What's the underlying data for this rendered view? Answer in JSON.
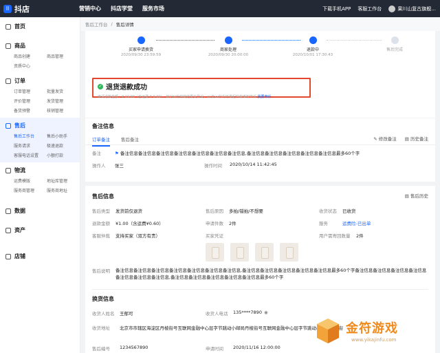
{
  "app": {
    "title": "抖店"
  },
  "topnav": [
    "营销中心",
    "抖店学堂",
    "服务市场"
  ],
  "topright": {
    "download": "下载手机APP",
    "workbench": "客服工作台",
    "shop": "果川山复古旗舰..."
  },
  "sidebar": {
    "home": "首页",
    "groups": [
      {
        "title": "商品",
        "items": [
          "商品创建",
          "商品管理",
          "资质中心"
        ]
      },
      {
        "title": "订单",
        "items": [
          "订单管理",
          "批量发货",
          "评价管理",
          "发货管理",
          "备货预警",
          "核销管理"
        ]
      },
      {
        "title": "售后",
        "items": [
          "售后工作台",
          "售后小助手",
          "服务请求",
          "极速退款",
          "客服电话设置",
          "小额打款"
        ]
      },
      {
        "title": "物流",
        "items": [
          "运费模版",
          "地址库管理",
          "服务商管理",
          "服务商地址"
        ]
      }
    ],
    "bottom": [
      "数据",
      "资产",
      "店铺"
    ]
  },
  "breadcrumb": [
    "售后工作台",
    "/",
    "售后详情"
  ],
  "steps": [
    {
      "label": "买家申请换货",
      "time": "2020/09/30 23:59:59"
    },
    {
      "label": "商家处理",
      "time": "2020/09/30 20:00:00"
    },
    {
      "label": "退款中",
      "time": "2020/10/01 17:30:43"
    },
    {
      "label": "售后完成",
      "time": ""
    }
  ],
  "status": {
    "title": "退货退款成功",
    "desc": "申请退款金额：¥ 19.00（含运费 ¥ 0.00），如对纠纷仲裁结果又异议，xx天xx秒内可发起仲裁维权申诉",
    "link": "我要申诉"
  },
  "notes": {
    "title": "备注信息",
    "tabs": [
      "订单备注",
      "售后备注"
    ],
    "actions": [
      "修改备注",
      "历史备注"
    ],
    "note_label": "备注",
    "note_value": "备注信息备注信息备注信息备注信息备注信息备注信息备注信息,备注信息备注信息备注信息备注信息备注信息最多60个字",
    "operator_label": "操作人",
    "operator": "张三",
    "optime_label": "操作时间",
    "optime": "2020/10/14  11:42:45"
  },
  "after": {
    "title": "售后信息",
    "history": "售后历史",
    "fields": [
      {
        "k": "售后类型",
        "v": "发货前仅退货"
      },
      {
        "k": "售后原因",
        "v": "多拍/错拍/不想要"
      },
      {
        "k": "收货状态",
        "v": "已收货"
      },
      {
        "k": "退款金额",
        "v": "¥1.00（含运费¥0.60）"
      },
      {
        "k": "申请件数",
        "v": "2件"
      },
      {
        "k": "服务",
        "v": "运费险-已出单"
      },
      {
        "k": "客服仲裁",
        "v": "支持买家（双方有责）"
      },
      {
        "k": "买家凭证",
        "v": ""
      },
      {
        "k": "用户需寄回数量",
        "v": "2件"
      }
    ],
    "desc_label": "售后说明",
    "desc": "备注信息备注信息备注信息备注信息备注信息备注信息备注信息,备注信息备注信息备注信息备注信息备注信息最多60个字备注信息备注信息备注信息备注信息备注信息备注信息备注信息,备注信息备注信息备注信息备注信息备注信息最多60个字"
  },
  "exchange": {
    "title": "换货信息",
    "receiver_label": "收货人姓名",
    "receiver": "王郁可",
    "phone_label": "收货人电话",
    "phone": "135****7890",
    "addr_label": "收货地址",
    "addr": "北京市市辖区海淀区丹棱街号互联网金融中心层字节跳动小邮局丹棱街号互联网金融中心层字节跳动小邮局丹棱街",
    "no_label": "售后编号",
    "no": "1234567890",
    "time_label": "申请时间",
    "time": "2020/11/16 12:00:00"
  },
  "watermark": {
    "text": "金符游戏",
    "url": "www.yikajinfu.com"
  },
  "colors": {
    "accent": "#1966ff",
    "highlight": "#e2472b",
    "success": "#2dba5a"
  }
}
